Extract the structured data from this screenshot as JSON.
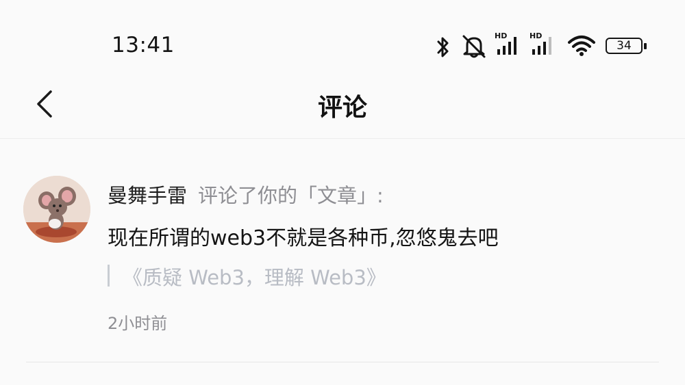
{
  "status_bar": {
    "time": "13:41",
    "hd_label_1": "HD",
    "hd_label_2": "HD",
    "battery_level": "34",
    "icons": [
      "bluetooth-icon",
      "mute-icon",
      "signal-icon",
      "signal-icon",
      "wifi-icon",
      "battery-icon"
    ]
  },
  "nav": {
    "title": "评论",
    "back_icon": "chevron-left-icon"
  },
  "notification": {
    "username": "曼舞手雷",
    "action": "评论了你的「文章」:",
    "comment": "现在所谓的web3不就是各种币,忽悠鬼去吧",
    "article_title": "《质疑 Web3，理解 Web3》",
    "time_ago": "2小时前"
  }
}
